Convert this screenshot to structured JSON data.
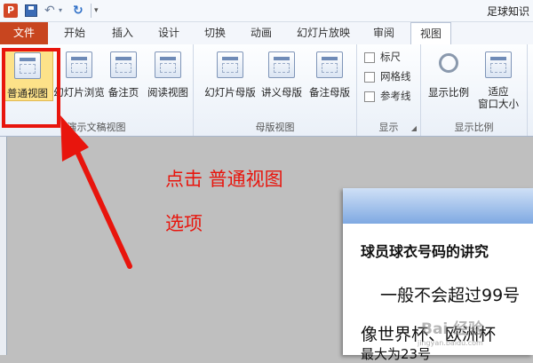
{
  "quick_access": {
    "app_icon": "P",
    "icons": [
      "powerpoint-icon",
      "save-icon",
      "undo-icon",
      "redo-icon"
    ]
  },
  "window": {
    "title": "足球知识"
  },
  "tabs": [
    {
      "label": "文件",
      "active": false
    },
    {
      "label": "开始",
      "active": false
    },
    {
      "label": "插入",
      "active": false
    },
    {
      "label": "设计",
      "active": false
    },
    {
      "label": "切换",
      "active": false
    },
    {
      "label": "动画",
      "active": false
    },
    {
      "label": "幻灯片放映",
      "active": false
    },
    {
      "label": "审阅",
      "active": false
    },
    {
      "label": "视图",
      "active": true
    }
  ],
  "ribbon": {
    "presentation_views": {
      "label": "演示文稿视图",
      "buttons": [
        {
          "label": "普通视图",
          "selected": true
        },
        {
          "label": "幻灯片浏览",
          "selected": false
        },
        {
          "label": "备注页",
          "selected": false
        },
        {
          "label": "阅读视图",
          "selected": false
        }
      ]
    },
    "master_views": {
      "label": "母版视图",
      "buttons": [
        {
          "label": "幻灯片母版"
        },
        {
          "label": "讲义母版"
        },
        {
          "label": "备注母版"
        }
      ]
    },
    "show": {
      "label": "显示",
      "checkboxes": [
        {
          "label": "标尺",
          "checked": false
        },
        {
          "label": "网格线",
          "checked": false
        },
        {
          "label": "参考线",
          "checked": false
        }
      ]
    },
    "zoom": {
      "label": "显示比例",
      "buttons": [
        {
          "label": "显示比例"
        },
        {
          "label": "适应\n窗口大小"
        }
      ]
    }
  },
  "annotation": {
    "line1": "点击  普通视图",
    "line2": "选项",
    "color": "#e8150d"
  },
  "slide": {
    "title": "球员球衣号码的讲究",
    "line1": "一般不会超过99号",
    "line2": "像世界杯、欧洲杯",
    "line3": "最大为23号"
  },
  "watermark": {
    "text": "Bai 经验",
    "sub": "jingyan.baidu.com"
  }
}
